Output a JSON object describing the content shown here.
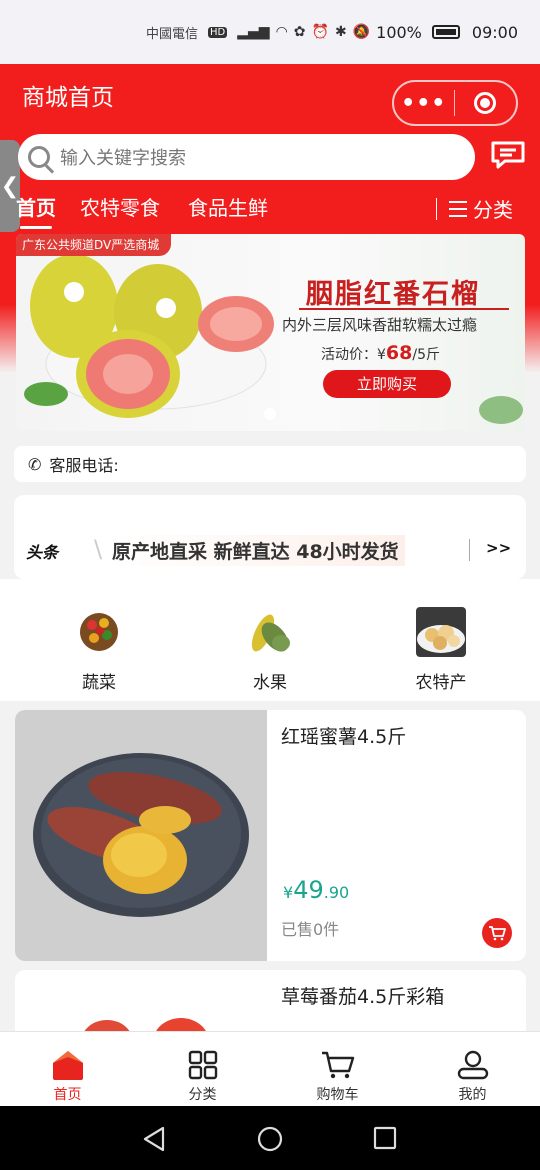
{
  "status_bar": {
    "carrier": "中國電信",
    "carrier_badge": "HD",
    "network": "⁶ᴳ",
    "battery": "100%",
    "time": "09:00"
  },
  "header": {
    "title": "商城首页",
    "menu_dots": "•••"
  },
  "search": {
    "placeholder": "输入关键字搜索"
  },
  "side_tab": {
    "glyph": "❮"
  },
  "nav_tabs": [
    {
      "label": "首页",
      "active": true
    },
    {
      "label": "农特零食"
    },
    {
      "label": "食品生鲜"
    }
  ],
  "category_menu": {
    "label": "分类"
  },
  "banner": {
    "tag": "广东公共频道DV严选商城",
    "headline": "胭脂红番石榴",
    "subline": "内外三层风味香甜软糯太过瘾",
    "price_prefix": "活动价：¥",
    "price_value": "68",
    "price_unit": "/5斤",
    "buy_label": "立即购买"
  },
  "service": {
    "label": "客服电话:"
  },
  "news": {
    "brand": "头条",
    "text": "原产地直采 新鲜直达 48小时发货",
    "more": ">>"
  },
  "categories": [
    {
      "label": "蔬菜",
      "icon": "vegetables-icon"
    },
    {
      "label": "水果",
      "icon": "fruit-icon"
    },
    {
      "label": "农特产",
      "icon": "specialty-icon"
    }
  ],
  "products": [
    {
      "name": "红瑶蜜薯4.5斤",
      "currency": "¥",
      "price_int": "49",
      "price_dec": ".90",
      "sold": "已售0件"
    },
    {
      "name": "草莓番茄4.5斤彩箱"
    }
  ],
  "tab_bar": [
    {
      "label": "首页",
      "active": true
    },
    {
      "label": "分类"
    },
    {
      "label": "购物车"
    },
    {
      "label": "我的"
    }
  ],
  "colors": {
    "brand_red": "#f21d1d",
    "price_green": "#1aa58f"
  }
}
